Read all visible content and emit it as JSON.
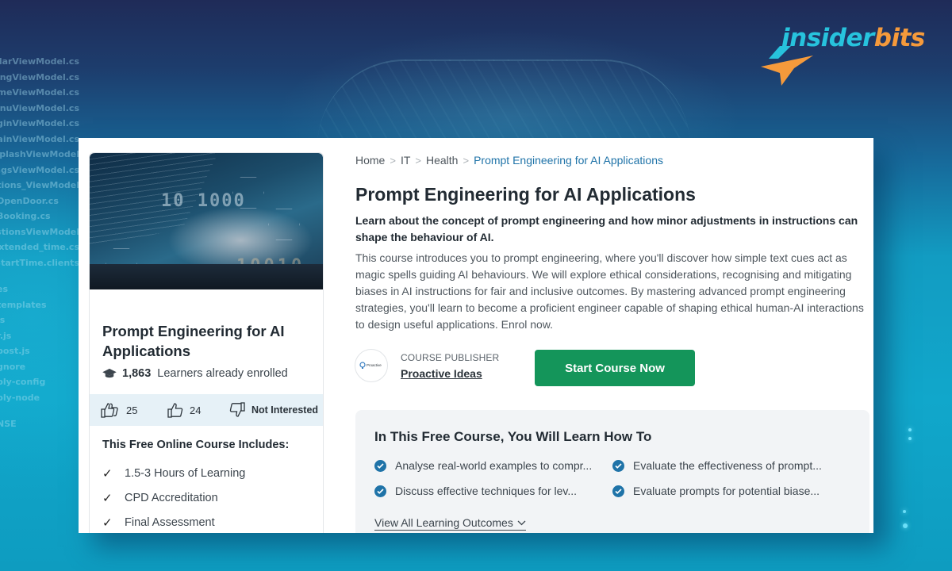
{
  "brand": {
    "logo_part1": "insider",
    "logo_part2": "bits",
    "colors": {
      "cyan": "#27c3dd",
      "orange": "#f59a3b",
      "primary_green": "#14955a",
      "link_blue": "#1f73a8"
    }
  },
  "background_code_lines": [
    "CalendarViewModel.cs",
    "BookingViewModel.cs",
    "HomeViewModel.cs",
    "MenuViewModel.cs",
    "LoginViewModel.cs",
    "MainViewModel.cs",
    "ExtendedSplashViewModel",
    "SettingsViewModel.cs",
    "Notifications_ViewModel",
    "OpenDoor.cs",
    "Booking.cs",
    "SuggestionsViewModel",
    "Extended_time.cs",
    "StartTime.clients",
    "",
    "es",
    "templates",
    "js",
    "r.js",
    "post.js",
    "gnore",
    "ply-config",
    "ply-node",
    "",
    "NSE"
  ],
  "card": {
    "image_alt": "hands typing on laptop with binary overlay",
    "image_text_1": "10 1000",
    "image_text_2": "10010",
    "title": "Prompt Engineering for AI Applications",
    "enrolled_count": "1,863",
    "enrolled_label": "Learners already enrolled",
    "feedback": {
      "loves": "25",
      "likes": "24",
      "not_interested": "Not Interested"
    },
    "includes_title": "This Free Online Course Includes:",
    "includes": [
      "1.5-3 Hours of Learning",
      "CPD Accreditation",
      "Final Assessment"
    ]
  },
  "breadcrumb": {
    "items": [
      "Home",
      "IT",
      "Health"
    ],
    "current": "Prompt Engineering for AI Applications"
  },
  "course": {
    "title": "Prompt Engineering for AI Applications",
    "subtitle": "Learn about the concept of prompt engineering and how minor adjustments in instructions can shape the behaviour of AI.",
    "description": "This course introduces you to prompt engineering, where you'll discover how simple text cues act as magic spells guiding AI behaviours. We will explore ethical considerations, recognising and mitigating biases in AI instructions for fair and inclusive outcomes. By mastering advanced prompt engineering strategies, you'll learn to become a proficient engineer capable of shaping ethical human-AI interactions to design useful applications. Enrol now.",
    "publisher_label": "COURSE PUBLISHER",
    "publisher_name": "Proactive Ideas",
    "publisher_logo_text": "Proactive",
    "start_button": "Start Course Now"
  },
  "learn": {
    "title": "In This Free Course, You Will Learn How To",
    "outcomes": [
      "Analyse real-world examples to compr...",
      "Evaluate the effectiveness of prompt...",
      "Discuss effective techniques for lev...",
      "Evaluate prompts for potential biase..."
    ],
    "view_all": "View All Learning Outcomes"
  }
}
